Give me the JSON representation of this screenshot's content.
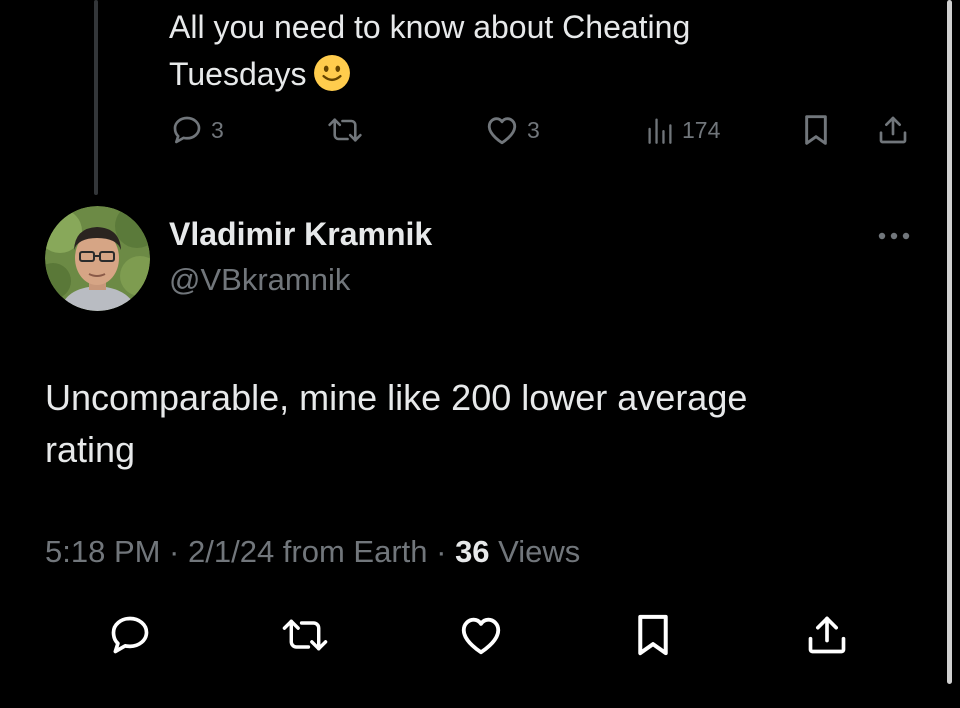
{
  "previous_tweet": {
    "text_line1": "All you need to know about Cheating",
    "text_line2": "Tuesdays",
    "emoji": "slightly-smiling-face",
    "actions": {
      "replies": "3",
      "likes": "3",
      "views": "174"
    }
  },
  "tweet": {
    "author_name": "Vladimir Kramnik",
    "author_handle": "@VBkramnik",
    "text_line1": "Uncomparable, mine like 200 lower average",
    "text_line2": "rating",
    "meta": {
      "time_date_source": "5:18 PM · 2/1/24 from Earth · ",
      "views_count": "36",
      "views_label": " Views"
    }
  },
  "icons": {
    "reply": "reply-icon",
    "retweet": "retweet-icon",
    "like": "heart-icon",
    "views": "analytics-icon",
    "bookmark": "bookmark-icon",
    "share": "share-icon",
    "more": "more-options-icon"
  },
  "colors": {
    "background": "#000000",
    "primary_text": "#e7e9ea",
    "secondary_text": "#71767b",
    "thread_line": "#333639",
    "icon_main": "#ffffff"
  }
}
